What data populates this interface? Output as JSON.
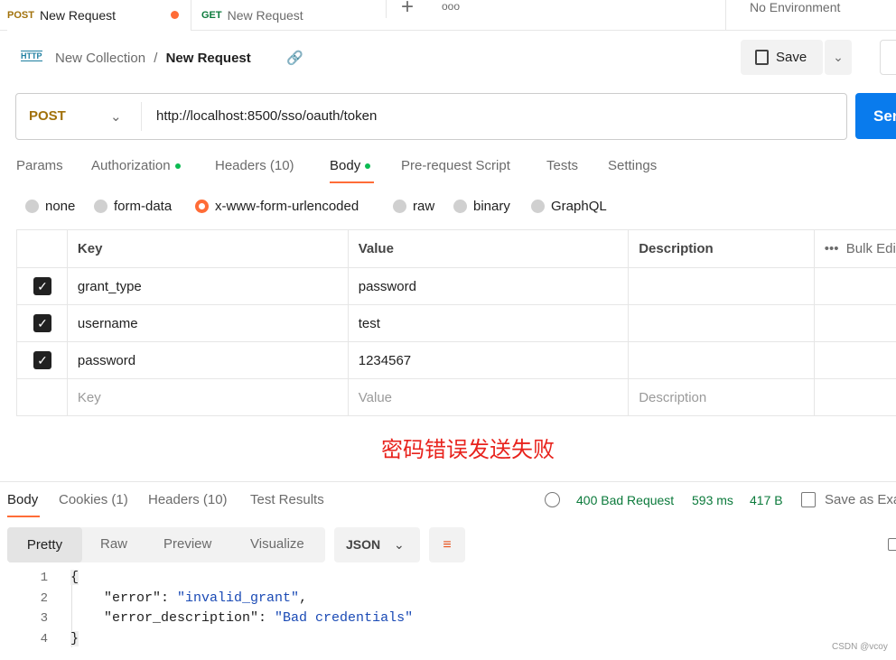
{
  "tabs": [
    {
      "method": "POST",
      "label": "New Request",
      "unsaved": true
    },
    {
      "method": "GET",
      "label": "New Request"
    }
  ],
  "environment": "No Environment",
  "breadcrumb": {
    "collection": "New Collection",
    "separator": "/",
    "request": "New Request"
  },
  "save_label": "Save",
  "request": {
    "method": "POST",
    "url": "http://localhost:8500/sso/oauth/token",
    "send_label": "Send"
  },
  "req_tabs": [
    "Params",
    "Authorization",
    "Headers (10)",
    "Body",
    "Pre-request Script",
    "Tests",
    "Settings"
  ],
  "body_types": [
    "none",
    "form-data",
    "x-www-form-urlencoded",
    "raw",
    "binary",
    "GraphQL"
  ],
  "selected_body_type": "x-www-form-urlencoded",
  "table": {
    "headers": [
      "Key",
      "Value",
      "Description",
      "Bulk Edit"
    ],
    "rows": [
      {
        "key": "grant_type",
        "value": "password",
        "checked": true
      },
      {
        "key": "username",
        "value": "test",
        "checked": true
      },
      {
        "key": "password",
        "value": "1234567",
        "checked": true
      }
    ],
    "placeholders": {
      "key": "Key",
      "value": "Value",
      "description": "Description"
    }
  },
  "annotation": "密码错误发送失败",
  "resp_tabs": [
    "Body",
    "Cookies (1)",
    "Headers (10)",
    "Test Results"
  ],
  "status": {
    "code": "400 Bad Request",
    "time": "593 ms",
    "size": "417 B",
    "save_example": "Save as Example"
  },
  "view_tabs": [
    "Pretty",
    "Raw",
    "Preview",
    "Visualize"
  ],
  "format": "JSON",
  "code": {
    "lines": [
      "1",
      "2",
      "3",
      "4"
    ],
    "open": "{",
    "close": "}",
    "k1": "\"error\"",
    "v1": "\"invalid_grant\"",
    "k2": "\"error_description\"",
    "v2": "\"Bad credentials\""
  },
  "watermark": "CSDN @vcoy",
  "colors": {
    "accent": "#ff6c37",
    "send": "#097bed",
    "success": "#0cbb52",
    "status": "#0b7a3b",
    "annotation": "#e8231d"
  }
}
